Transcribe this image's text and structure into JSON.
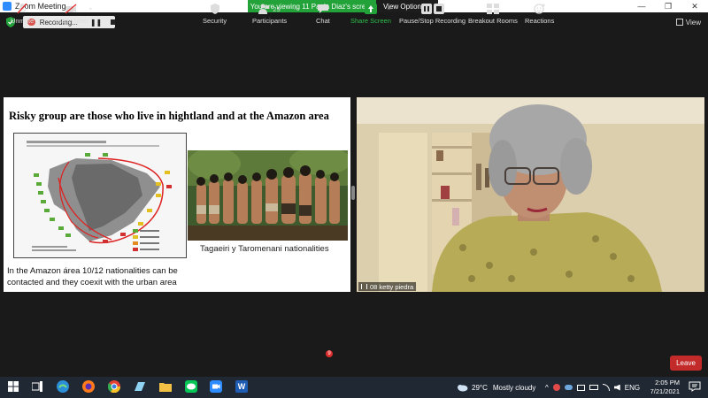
{
  "window": {
    "title": "Zoom Meeting",
    "minimize": "—",
    "maximize": "❐",
    "close": "✕"
  },
  "banner": {
    "viewing_text": "You are viewing 11 Paola Diaz's screen",
    "view_options_label": "View Options",
    "view_options_caret": "▾"
  },
  "recording": {
    "label": "Recording...",
    "pause_glyph": "❚❚"
  },
  "view_button": {
    "label": "View"
  },
  "slide": {
    "title": "Risky group are those who live in hightland and at the Amazon area",
    "photo_caption": "Tagaeiri y Taromenani  nationalities",
    "body_text": "In the Amazon área 10/12 nationalities can be contacted and they coexit with the urban area"
  },
  "speaker": {
    "name_tag": "08 ketty piedra"
  },
  "toolbar": {
    "unmute_label": "Unmute",
    "start_video_label": "Start Video",
    "security_label": "Security",
    "participants_label": "Participants",
    "participants_count": "29",
    "chat_label": "Chat",
    "chat_badge": "9",
    "share_screen_label": "Share Screen",
    "pause_stop_recording_label": "Pause/Stop Recording",
    "breakout_rooms_label": "Breakout Rooms",
    "reactions_label": "Reactions",
    "leave_label": "Leave",
    "caret": "^"
  },
  "taskbar": {
    "weather_temp": "29°C",
    "weather_text": "Mostly cloudy",
    "tray_up": "^",
    "language": "ENG",
    "time": "2:05 PM",
    "date": "7/21/2021",
    "word_letter": "W"
  },
  "colors": {
    "share_green": "#23a23a",
    "leave_red": "#c32b2b",
    "toolbar_bg": "#1a1a1a",
    "taskbar_bg": "#202833"
  }
}
